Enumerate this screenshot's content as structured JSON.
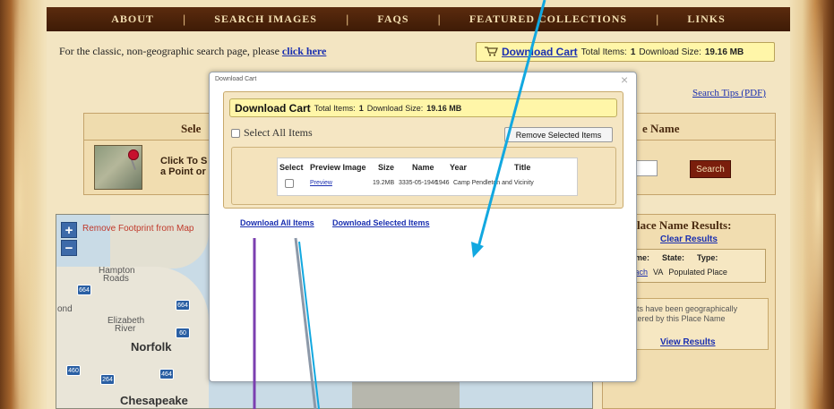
{
  "nav": {
    "items": [
      "ABOUT",
      "SEARCH IMAGES",
      "FAQS",
      "FEATURED COLLECTIONS",
      "LINKS"
    ],
    "sep": "|"
  },
  "classic": {
    "text": "For the classic, non-geographic search page, please ",
    "link": "click here"
  },
  "cart_top": {
    "link": "Download Cart",
    "items_label": "Total Items:",
    "items_value": "1",
    "size_label": "Download Size:",
    "size_value": "19.16 MB"
  },
  "search_tips": "Search Tips (PDF)",
  "left_panel": {
    "title": "Sele",
    "click_line1": "Click To S",
    "click_line2": "a Point or"
  },
  "right_panel": {
    "title": "e Name",
    "search_button": "Search"
  },
  "map": {
    "remove_footprint": "Remove Footprint from Map",
    "zoom_in": "+",
    "zoom_out": "−",
    "labels": {
      "hampton": "Hampton",
      "roads": "Roads",
      "ond": "ond",
      "elizabeth": "Elizabeth",
      "river": "River",
      "norfolk": "Norfolk",
      "chesapeake": "Chesapeake"
    },
    "roads": [
      "664",
      "664",
      "60",
      "460",
      "264",
      "464"
    ]
  },
  "results": {
    "title": "lace Name Results:",
    "clear": "Clear Results",
    "cols": [
      "e Name:",
      "State:",
      "Type:"
    ],
    "row": {
      "name": "a Beach",
      "state": "VA",
      "type": "Populated Place"
    },
    "note_line1": "lts have been geographically",
    "note_line2": "tered by this Place Name",
    "view": "View Results"
  },
  "modal": {
    "title": "Download Cart",
    "close": "×",
    "cart_bar": {
      "title": "Download Cart",
      "items_label": "Total Items:",
      "items_value": "1",
      "size_label": "Download Size:",
      "size_value": "19.16 MB"
    },
    "select_all": "Select All Items",
    "remove_selected": "Remove Selected Items",
    "table": {
      "headers": [
        "Select",
        "Preview Image",
        "Size",
        "Name",
        "Year",
        "Title"
      ],
      "row": {
        "preview": "Preview",
        "size": "19.2MB",
        "name": "3335-05-1946",
        "year": "1946",
        "title": "Camp Pendleton and Vicinity"
      }
    },
    "download_all": "Download All Items",
    "download_selected": "Download Selected Items"
  },
  "colors": {
    "nav_bg": "#4a200a",
    "link": "#1a2fb0",
    "cart_bg": "#fff6a8",
    "annot_blue": "#12a8e0",
    "annot_purple": "#7b3fb0",
    "annot_grey": "#8c98a8"
  }
}
